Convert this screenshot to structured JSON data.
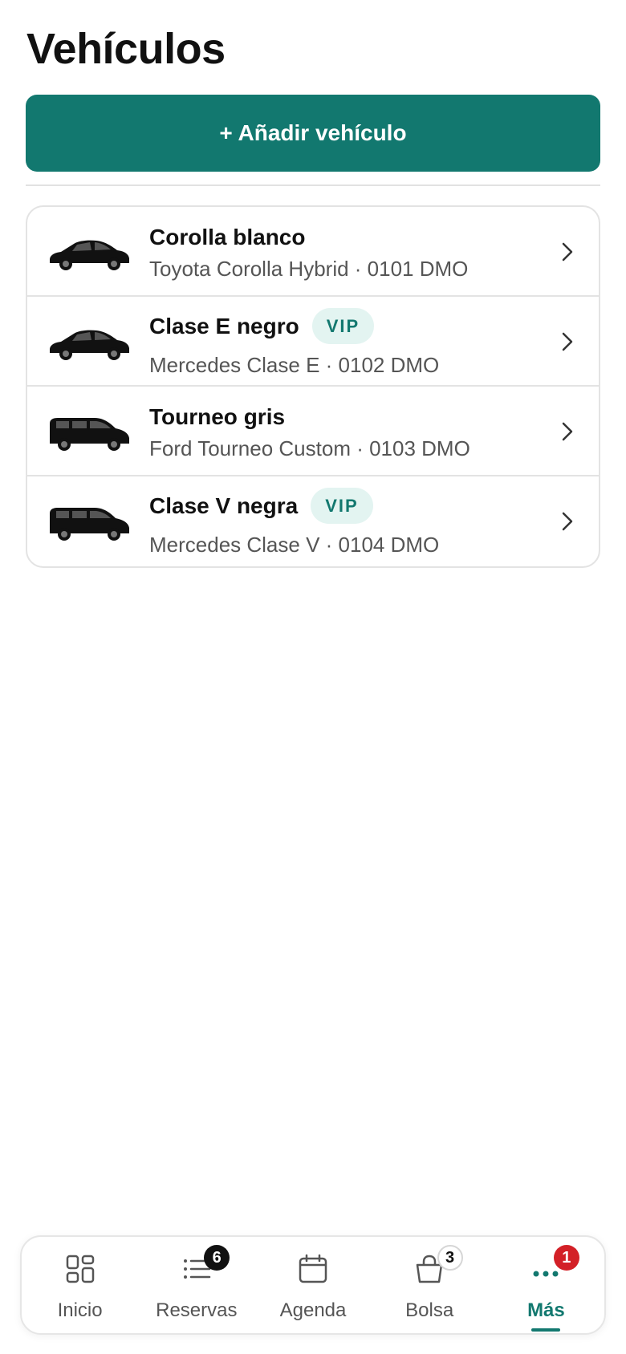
{
  "header": {
    "title": "Vehículos"
  },
  "actions": {
    "add_vehicle_label": "+ Añadir vehículo"
  },
  "vehicles": [
    {
      "name": "Corolla blanco",
      "detail": "Toyota Corolla Hybrid · 0101 DMO",
      "badge": "",
      "type": "sedan"
    },
    {
      "name": "Clase E negro",
      "detail": "Mercedes Clase E · 0102 DMO",
      "badge": "VIP",
      "type": "sedan"
    },
    {
      "name": "Tourneo gris",
      "detail": "Ford Tourneo Custom · 0103 DMO",
      "badge": "",
      "type": "van"
    },
    {
      "name": "Clase V negra",
      "detail": "Mercedes Clase V · 0104 DMO",
      "badge": "VIP",
      "type": "van"
    }
  ],
  "nav": {
    "items": [
      {
        "label": "Inicio",
        "icon": "grid-icon",
        "badge": ""
      },
      {
        "label": "Reservas",
        "icon": "list-icon",
        "badge": "6"
      },
      {
        "label": "Agenda",
        "icon": "calendar-icon",
        "badge": ""
      },
      {
        "label": "Bolsa",
        "icon": "bag-icon",
        "badge": "3"
      },
      {
        "label": "Más",
        "icon": "more-icon",
        "badge": "1",
        "active": true
      }
    ]
  },
  "colors": {
    "accent": "#12786f",
    "vip_bg": "#e3f4f1",
    "alert": "#d32027"
  }
}
